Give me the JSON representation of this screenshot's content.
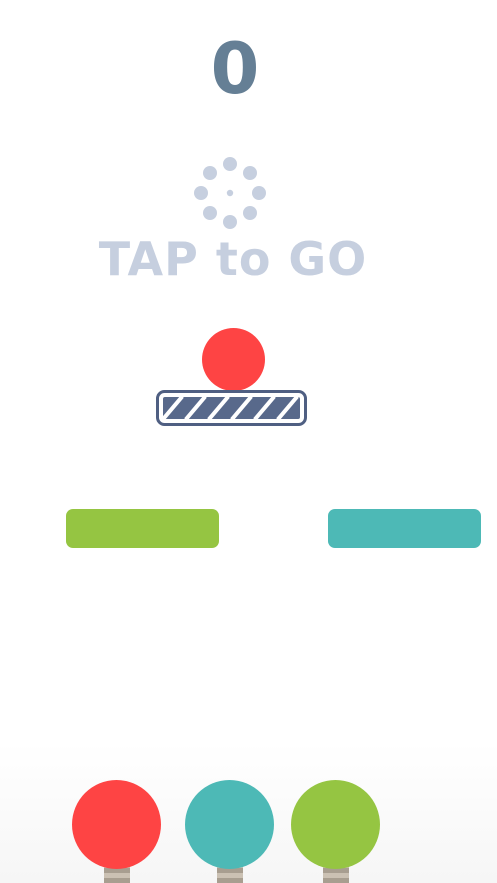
{
  "game": {
    "score": "0",
    "tap_prompt": "TAP to GO",
    "player_ball_color": "#fe4444",
    "platform_color": "#58698b",
    "platform_border_color": "#4f5f82"
  },
  "bars": [
    {
      "color": "#95c542"
    },
    {
      "color": "#4db9b6"
    }
  ],
  "color_choices": [
    {
      "name": "red",
      "color": "#fe4444"
    },
    {
      "name": "teal",
      "color": "#4db9b6"
    },
    {
      "name": "green",
      "color": "#95c542"
    }
  ],
  "icons": {
    "tap_prompt_icon": "tap-burst-icon"
  }
}
